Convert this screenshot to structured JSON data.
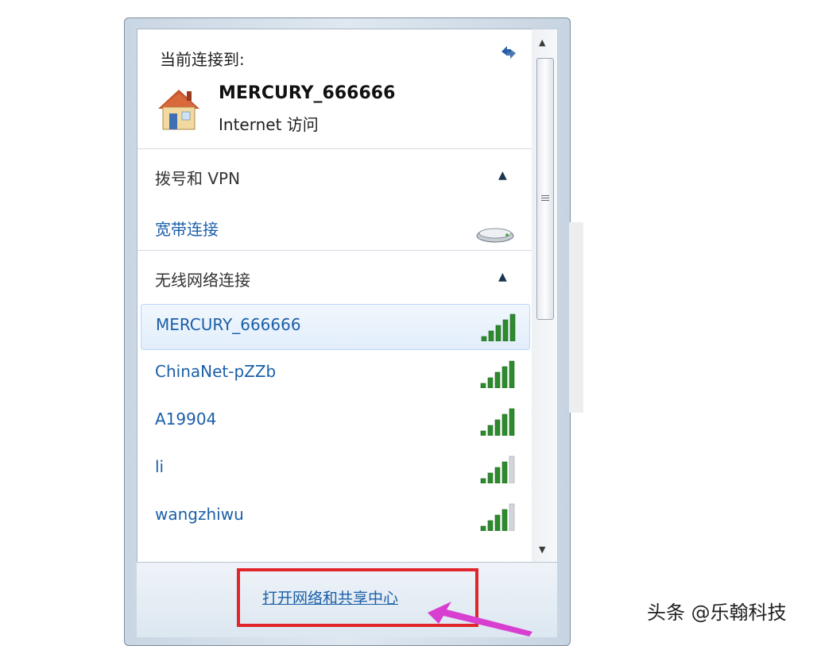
{
  "header": {
    "label": "当前连接到:"
  },
  "current_connection": {
    "name": "MERCURY_666666",
    "status": "Internet 访问"
  },
  "dialup_section": {
    "title": "拨号和 VPN",
    "items": [
      {
        "label": "宽带连接"
      }
    ]
  },
  "wireless_section": {
    "title": "无线网络连接",
    "networks": [
      {
        "name": "MERCURY_666666",
        "selected": true,
        "signal_bars": 5
      },
      {
        "name": "ChinaNet-pZZb",
        "selected": false,
        "signal_bars": 5
      },
      {
        "name": "A19904",
        "selected": false,
        "signal_bars": 5
      },
      {
        "name": "li",
        "selected": false,
        "signal_bars": 4
      },
      {
        "name": "wangzhiwu",
        "selected": false,
        "signal_bars": 4
      }
    ]
  },
  "footer": {
    "open_center_link": "打开网络和共享中心"
  },
  "watermark": "头条 @乐翰科技",
  "colors": {
    "link": "#1b5fa8",
    "highlight": "#e0262a",
    "arrow": "#d83fd0",
    "signal_on": "#2e8a2e"
  }
}
